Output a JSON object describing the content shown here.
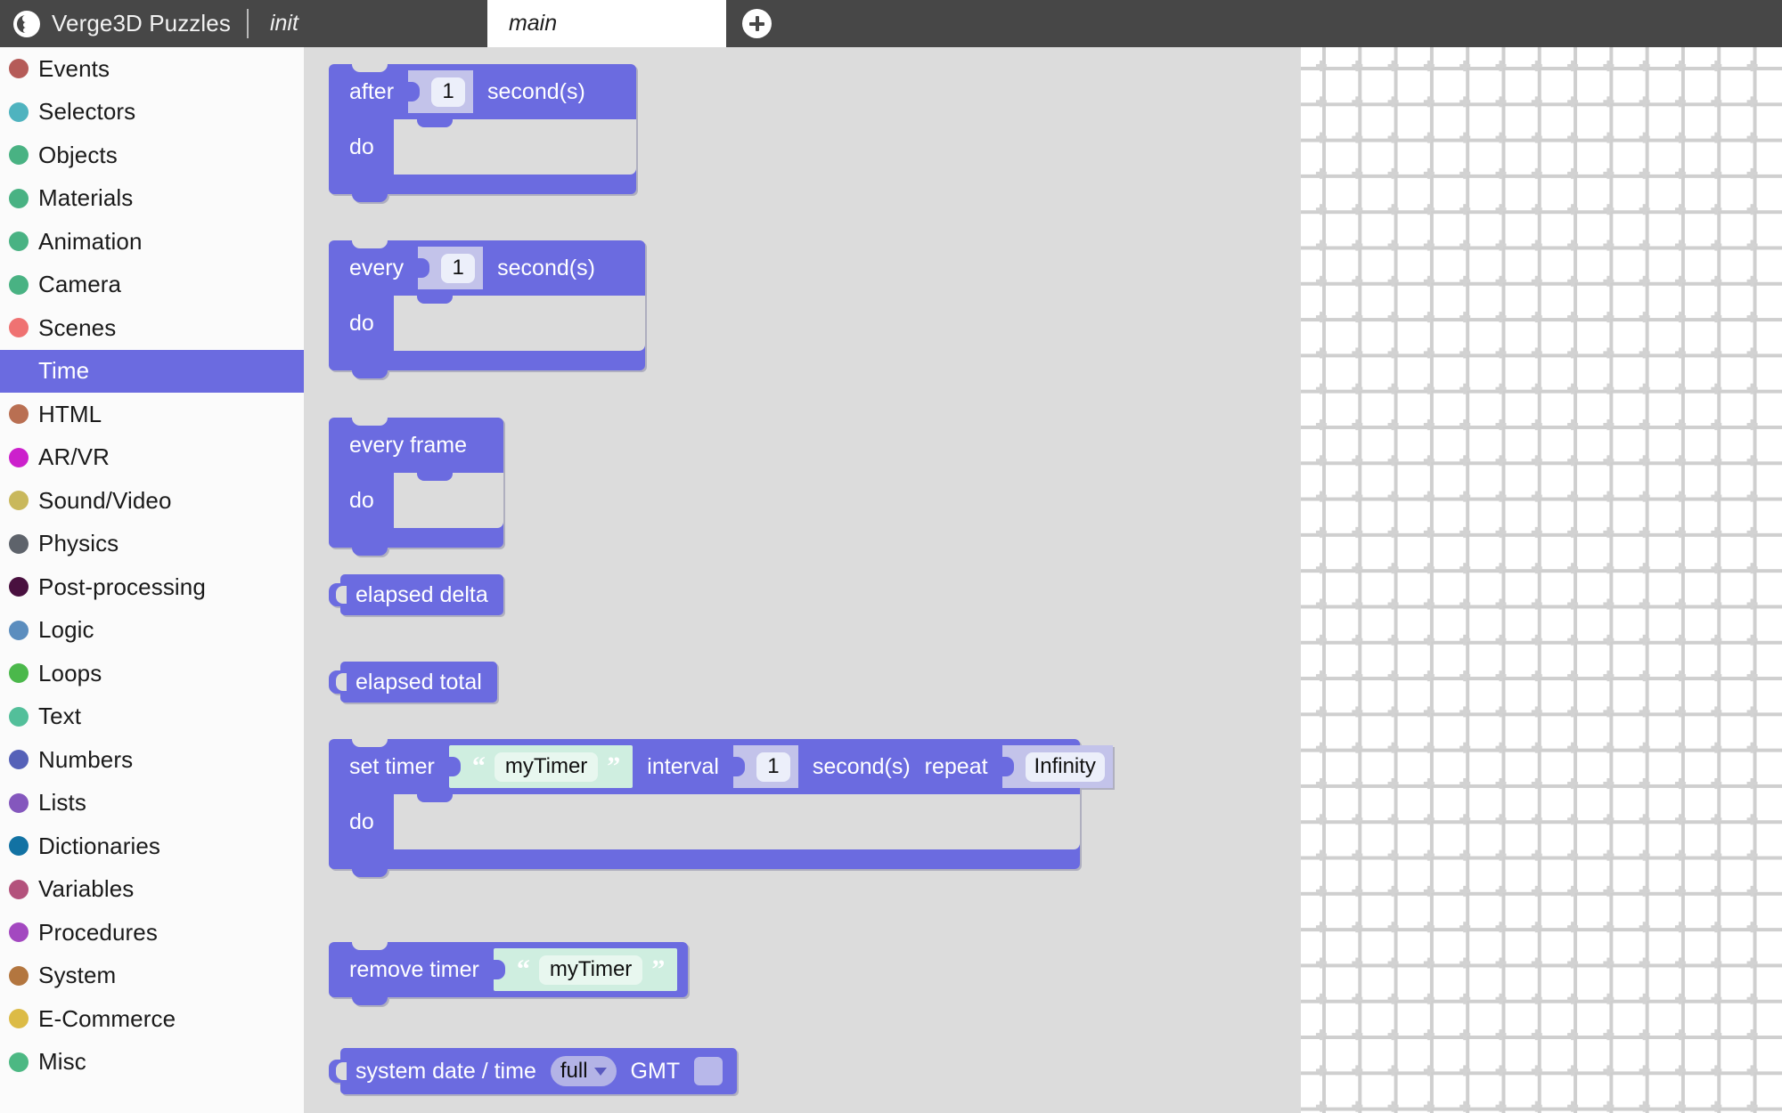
{
  "app": {
    "title": "Verge3D Puzzles",
    "logo_icon": "verge3d-puzzle-logo-icon"
  },
  "tabs": {
    "items": [
      {
        "label": "init",
        "active": false
      },
      {
        "label": "main",
        "active": true
      }
    ],
    "add_tab_icon": "plus-circle-icon",
    "add_tab_title": "add tab"
  },
  "sidebar": {
    "selected": "Time",
    "items": [
      {
        "label": "Events",
        "color": "#b55b58"
      },
      {
        "label": "Selectors",
        "color": "#4fb3bf"
      },
      {
        "label": "Objects",
        "color": "#49b283"
      },
      {
        "label": "Materials",
        "color": "#49b283"
      },
      {
        "label": "Animation",
        "color": "#49b283"
      },
      {
        "label": "Camera",
        "color": "#49b283"
      },
      {
        "label": "Scenes",
        "color": "#ef7272"
      },
      {
        "label": "Time",
        "color": "#6b6be0"
      },
      {
        "label": "HTML",
        "color": "#b96f52"
      },
      {
        "label": "AR/VR",
        "color": "#cc20cc"
      },
      {
        "label": "Sound/Video",
        "color": "#c9b85c"
      },
      {
        "label": "Physics",
        "color": "#5e636b"
      },
      {
        "label": "Post-processing",
        "color": "#49103f"
      },
      {
        "label": "Logic",
        "color": "#5b8dbe"
      },
      {
        "label": "Loops",
        "color": "#4bb84b"
      },
      {
        "label": "Text",
        "color": "#53bf9a"
      },
      {
        "label": "Numbers",
        "color": "#5561b8"
      },
      {
        "label": "Lists",
        "color": "#8457bd"
      },
      {
        "label": "Dictionaries",
        "color": "#1272a3"
      },
      {
        "label": "Variables",
        "color": "#b3527c"
      },
      {
        "label": "Procedures",
        "color": "#a348c0"
      },
      {
        "label": "System",
        "color": "#b3763f"
      },
      {
        "label": "E-Commerce",
        "color": "#dcbb46"
      },
      {
        "label": "Misc",
        "color": "#4cb883"
      }
    ]
  },
  "flyout": {
    "category": "Time",
    "block_color": "#6b6be0",
    "blocks": {
      "after": {
        "name": "after-seconds-block",
        "label": "after",
        "value": "1",
        "unit": "second(s)",
        "do_label": "do"
      },
      "every": {
        "name": "every-seconds-block",
        "label": "every",
        "value": "1",
        "unit": "second(s)",
        "do_label": "do"
      },
      "every_frame": {
        "name": "every-frame-block",
        "label": "every frame",
        "do_label": "do"
      },
      "elapsed_delta": {
        "name": "elapsed-delta-block",
        "label": "elapsed delta"
      },
      "elapsed_total": {
        "name": "elapsed-total-block",
        "label": "elapsed total"
      },
      "set_timer": {
        "name": "set-timer-block",
        "label": "set timer",
        "timer_name": "myTimer",
        "interval_label": "interval",
        "interval_value": "1",
        "unit": "second(s)",
        "repeat_label": "repeat",
        "repeat_value": "Infinity",
        "do_label": "do"
      },
      "remove_timer": {
        "name": "remove-timer-block",
        "label": "remove timer",
        "timer_name": "myTimer"
      },
      "system_date_time": {
        "name": "system-date-time-block",
        "label": "system date / time",
        "format": "full",
        "gmt_label": "GMT",
        "gmt_checked": false
      }
    }
  }
}
